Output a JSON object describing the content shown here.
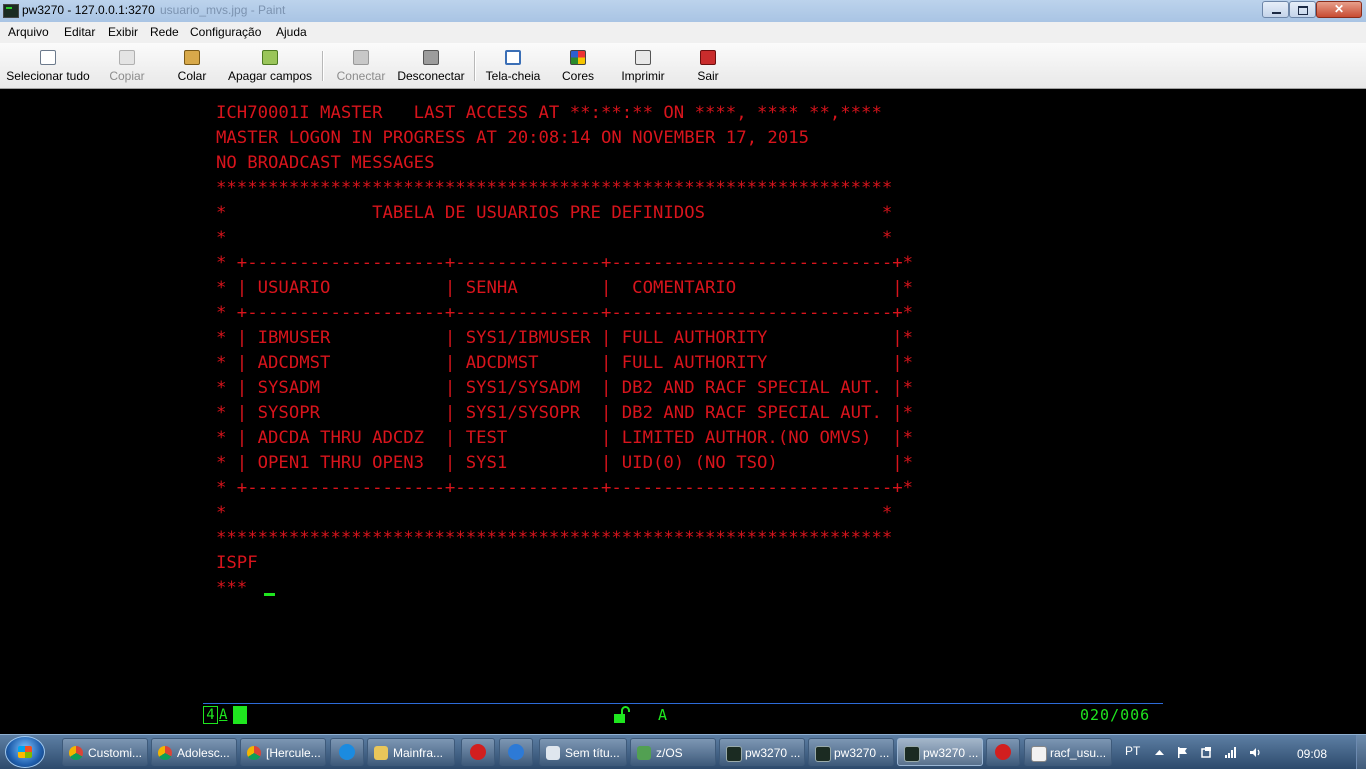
{
  "window": {
    "title": "pw3270 - 127.0.0.1:3270",
    "ghost_title": "usuario_mvs.jpg - Paint"
  },
  "menu": [
    "Arquivo",
    "Editar",
    "Exibir",
    "Rede",
    "Configuração",
    "Ajuda"
  ],
  "toolbar": {
    "select_all": "Selecionar tudo",
    "copy": "Copiar",
    "paste": "Colar",
    "clear_fields": "Apagar campos",
    "connect": "Conectar",
    "disconnect": "Desconectar",
    "fullscreen": "Tela-cheia",
    "colors": "Cores",
    "print": "Imprimir",
    "exit": "Sair"
  },
  "terminal": {
    "lines": [
      "ICH70001I MASTER   LAST ACCESS AT **:**:** ON ****, **** **,****",
      "MASTER LOGON IN PROGRESS AT 20:08:14 ON NOVEMBER 17, 2015",
      "NO BROADCAST MESSAGES",
      "*****************************************************************",
      "*              TABELA DE USUARIOS PRE DEFINIDOS                 *",
      "*                                                               *",
      "* +-------------------+--------------+---------------------------+*",
      "* | USUARIO           | SENHA        |  COMENTARIO               |*",
      "* +-------------------+--------------+---------------------------+*",
      "* | IBMUSER           | SYS1/IBMUSER | FULL AUTHORITY            |*",
      "* | ADCDMST           | ADCDMST      | FULL AUTHORITY            |*",
      "* | SYSADM            | SYS1/SYSADM  | DB2 AND RACF SPECIAL AUT. |*",
      "* | SYSOPR            | SYS1/SYSOPR  | DB2 AND RACF SPECIAL AUT. |*",
      "* | ADCDA THRU ADCDZ  | TEST         | LIMITED AUTHOR.(NO OMVS)  |*",
      "* | OPEN1 THRU OPEN3  | SYS1         | UID(0) (NO TSO)           |*",
      "* +-------------------+--------------+---------------------------+*",
      "*                                                               *",
      "*****************************************************************",
      "ISPF",
      "***"
    ]
  },
  "status": {
    "box": "4",
    "mode": "A",
    "indicator": "A",
    "cursor_position": "020/006"
  },
  "taskbar": {
    "tasks": [
      "Customi...",
      "Adolesc...",
      "[Hercule...",
      "",
      "Mainfra...",
      "",
      "",
      "Sem títu...",
      "z/OS",
      "pw3270 ...",
      "pw3270 ...",
      "pw3270 ...",
      "",
      "racf_usu..."
    ],
    "lang": "PT",
    "clock": "09:08"
  },
  "colors": {
    "terminal_text": "#d8141c",
    "oia_green": "#1fe61f",
    "oia_line": "#2d6bd8"
  }
}
